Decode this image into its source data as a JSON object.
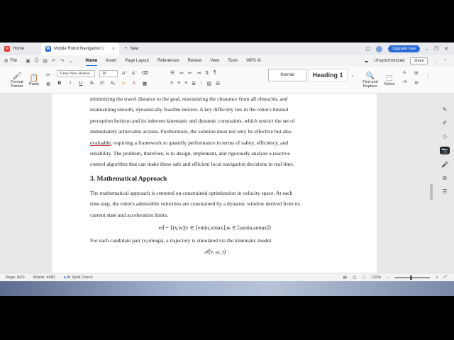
{
  "tabs": {
    "home": "Home",
    "doc": "Mobile Robot Navigation U",
    "new": "New"
  },
  "titlebar": {
    "upgrade": "Upgrade now"
  },
  "menu": {
    "file": "File",
    "tabs": [
      "Home",
      "Insert",
      "Page Layout",
      "References",
      "Review",
      "View",
      "Tools",
      "WPS AI"
    ],
    "sync": "Unsynchronized",
    "share": "Share"
  },
  "ribbon": {
    "format_painter": "Format Painter",
    "paste": "Paste",
    "font": "Times New Roman",
    "size": "16",
    "style_normal": "Normal",
    "style_h1": "Heading 1",
    "find_replace": "Find and Replace",
    "select": "Select"
  },
  "doc": {
    "para1_lines": [
      "minimizing the travel distance to the goal, maximizing the clearance from all obstacles, and",
      "maintaining smooth, dynamically feasible motion. A key difficulty lies in the robot's limited",
      "perception horizon and its inherent kinematic and dynamic constraints, which restrict the set of",
      "immediately achievable actions. Furthermore, the solution must not only be effective but also"
    ],
    "para1_last_a": "evaluable",
    "para1_last_b": ", requiring a framework to quantify performance in terms of safety, efficiency, and",
    "para1_tail": [
      "reliability. The problem, therefore, is to design, implement, and rigorously analyze a reactive",
      "control algorithm that can make these safe and efficient local navigation decisions in real time."
    ],
    "heading": "3. Mathematical Approach",
    "para2_lines": [
      "The mathematical approach is centered on constrained optimization in velocity space. At each",
      "time step, the robot's admissible velocities are constrained by a dynamic window derived from its",
      "current state and acceleration limits:"
    ],
    "equation1": "vd = {(v,w)|v ∈ [vmin,vmax],w ∈ [ωmin,ωmax]}",
    "para3": "For each candidate pair (v,omega), a trajectory is simulated via the kinematic model.",
    "equation2": "𝒯(v, ω, t)"
  },
  "status": {
    "page": "Page: 8/20",
    "words": "Words: 4682",
    "spell": "AI Spell Check",
    "zoom": "120%"
  }
}
